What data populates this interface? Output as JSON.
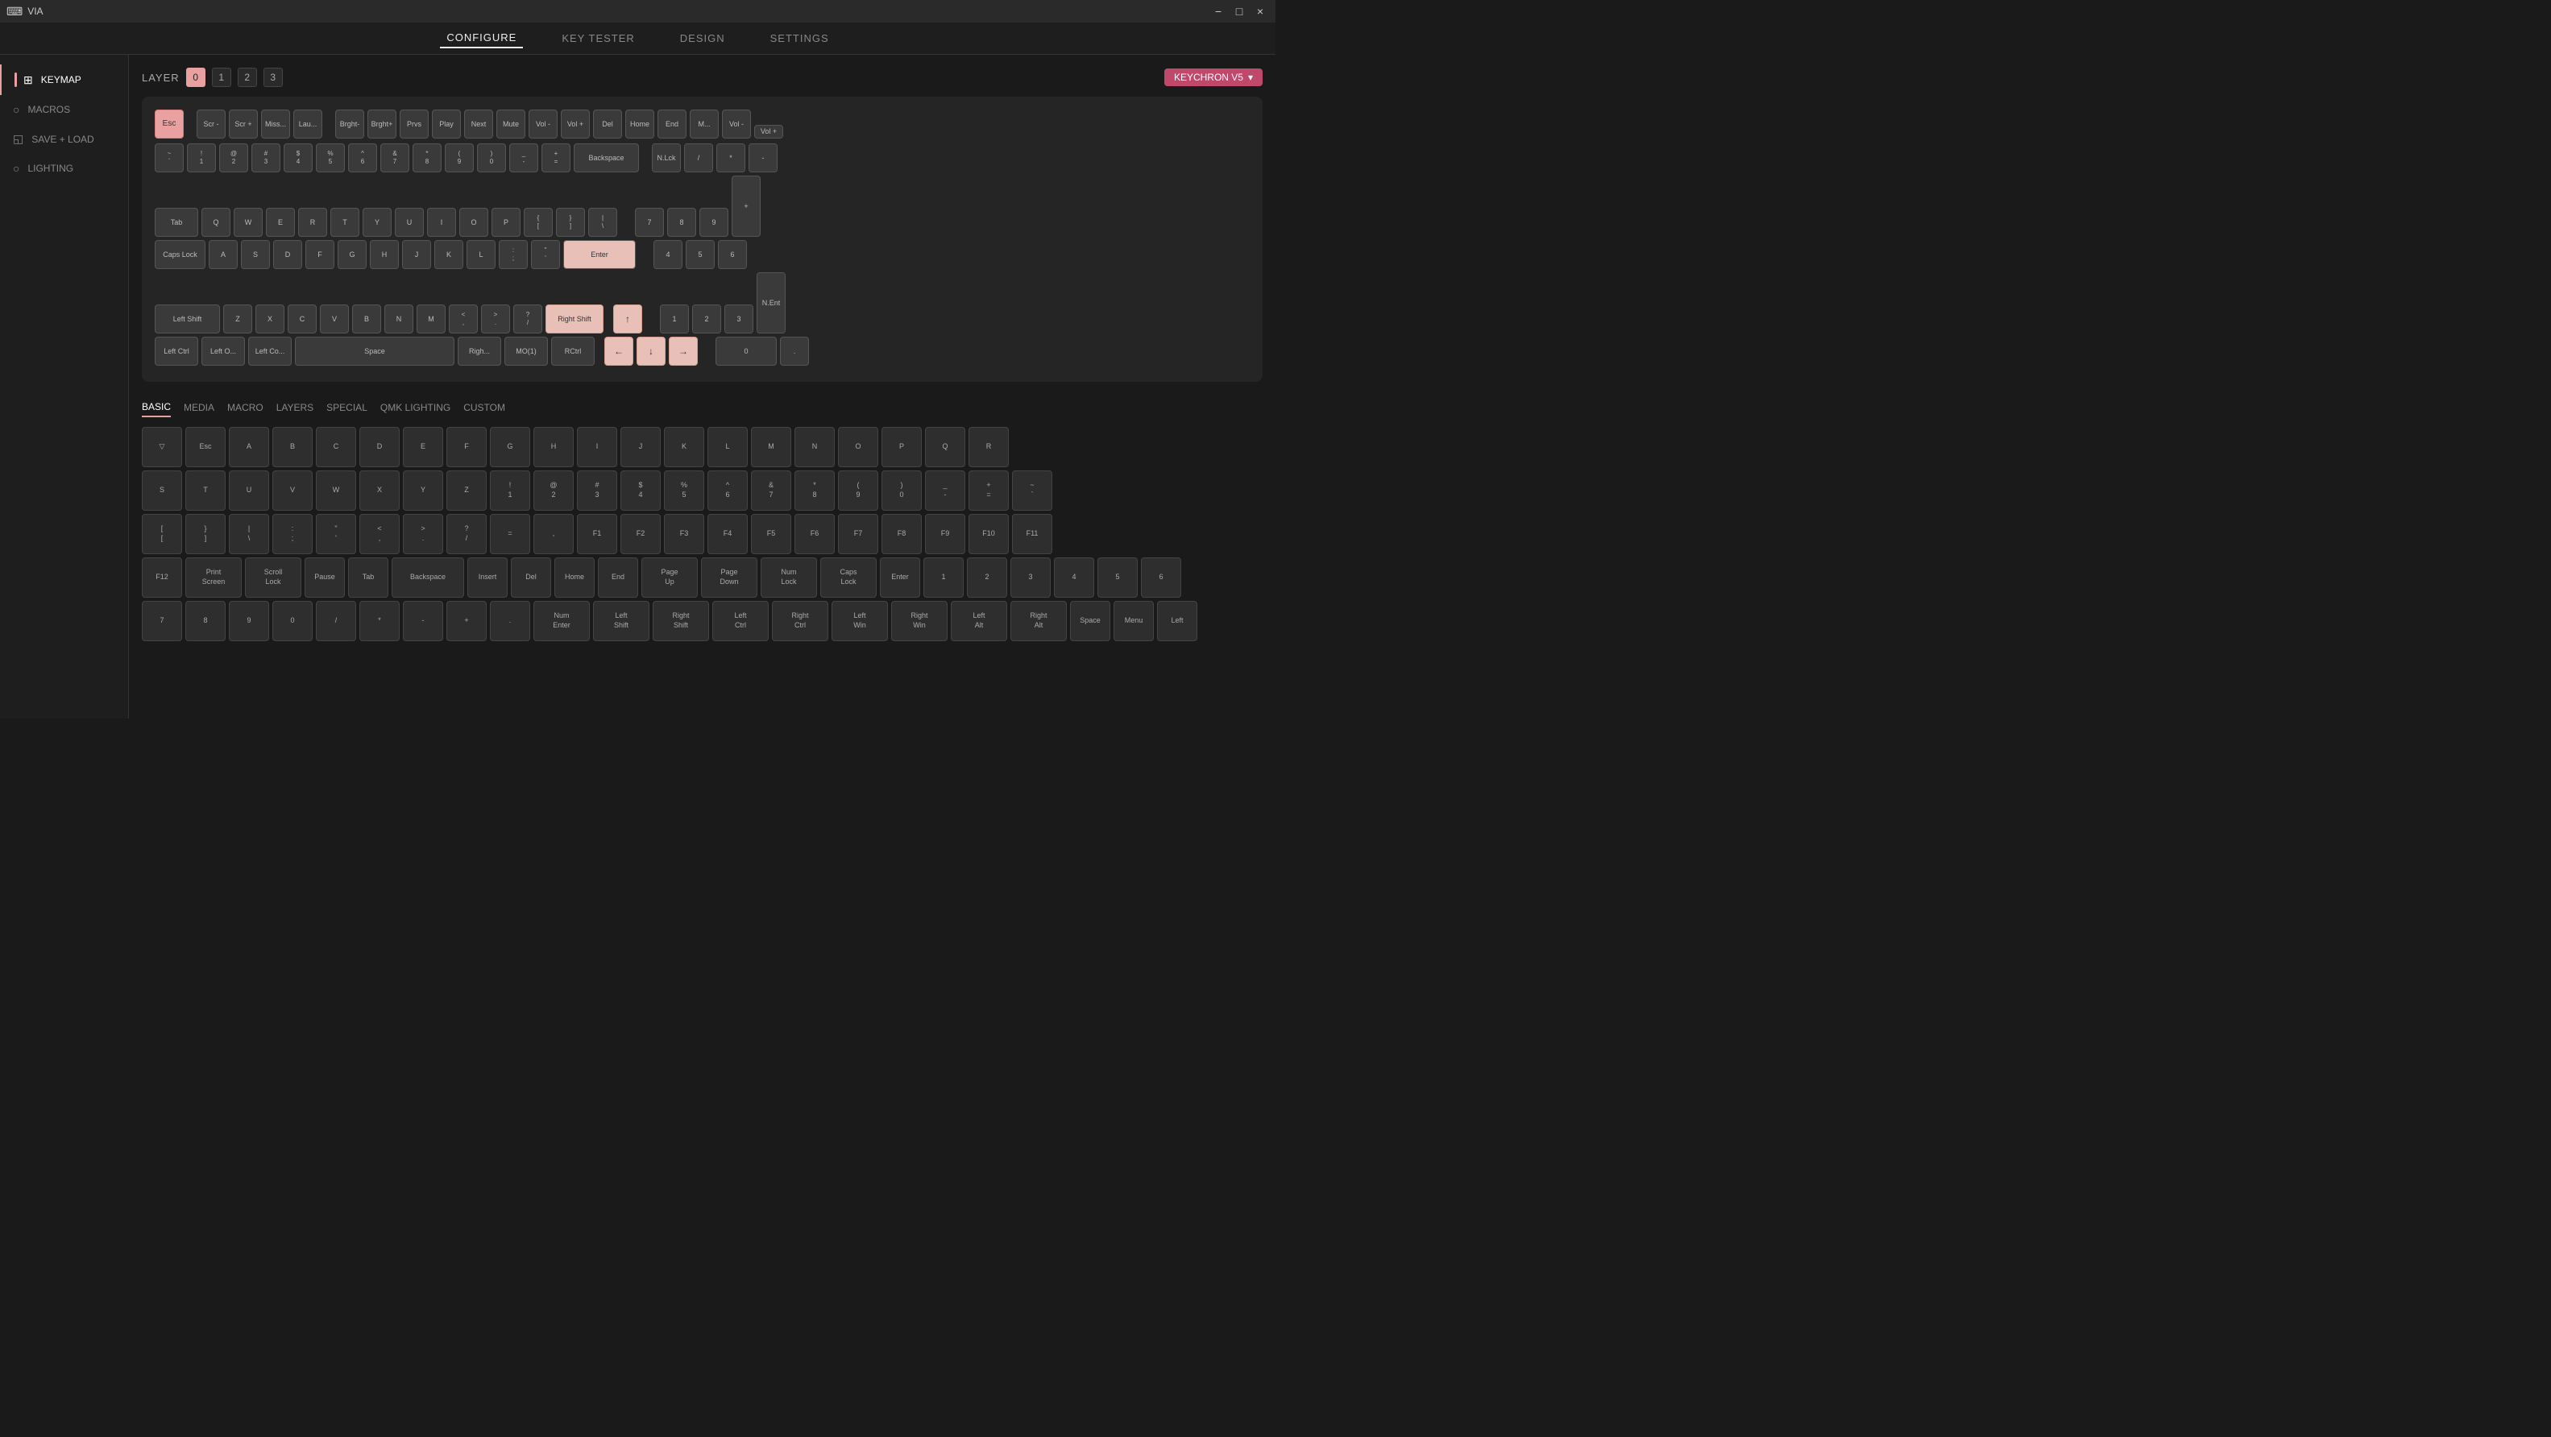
{
  "titlebar": {
    "app_name": "VIA",
    "minimize_label": "−",
    "maximize_label": "□",
    "close_label": "×"
  },
  "topnav": {
    "items": [
      {
        "id": "configure",
        "label": "CONFIGURE",
        "active": true
      },
      {
        "id": "key_tester",
        "label": "KEY TESTER",
        "active": false
      },
      {
        "id": "design",
        "label": "DESIGN",
        "active": false
      },
      {
        "id": "settings",
        "label": "SETTINGS",
        "active": false
      }
    ]
  },
  "sidebar": {
    "items": [
      {
        "id": "keymap",
        "label": "KEYMAP",
        "icon": "⊞",
        "active": true
      },
      {
        "id": "macros",
        "label": "MACROS",
        "icon": "○",
        "active": false
      },
      {
        "id": "save_load",
        "label": "SAVE + LOAD",
        "icon": "◱",
        "active": false
      },
      {
        "id": "lighting",
        "label": "LIGHTING",
        "icon": "○",
        "active": false
      }
    ]
  },
  "keyboard": {
    "selector_label": "KEYCHRON V5",
    "layer_label": "LAYER",
    "layers": [
      "0",
      "1",
      "2",
      "3"
    ],
    "active_layer": "0"
  },
  "keyboard_keys": {
    "row0": [
      "Esc",
      "",
      "Scr -",
      "Scr +",
      "Miss...",
      "Lau...",
      "",
      "Brght-",
      "Brght+",
      "Prvs",
      "Play",
      "Next",
      "Mute",
      "Vol -",
      "Vol +",
      "Del",
      "Home",
      "End",
      "M...",
      "Vol -",
      "",
      "Vol +"
    ],
    "row1": [
      "~\n`",
      "!\n1",
      "@\n2",
      "#\n3",
      "$\n4",
      "%\n5",
      "^\n6",
      "&\n7",
      "*\n8",
      "(\n9",
      ")\n0",
      "_\n-",
      "+\n=",
      "Backspace",
      "",
      "N.Lck",
      "/",
      "*",
      "-"
    ],
    "row2": [
      "Tab",
      "Q",
      "W",
      "E",
      "R",
      "T",
      "Y",
      "U",
      "I",
      "O",
      "P",
      "{\n[",
      "}\n]",
      "|\n\\",
      "",
      "7",
      "8",
      "9",
      "+"
    ],
    "row3": [
      "Caps Lock",
      "A",
      "S",
      "D",
      "F",
      "G",
      "H",
      "J",
      "K",
      "L",
      ":\n;",
      "\"\n'",
      "Enter",
      "",
      "4",
      "5",
      "6"
    ],
    "row4": [
      "Left Shift",
      "Z",
      "X",
      "C",
      "V",
      "B",
      "N",
      "M",
      "<\n,",
      ">\n.",
      "?\n/",
      "Right Shift",
      "",
      "↑",
      "",
      "1",
      "2",
      "3",
      "N.Ent"
    ],
    "row5": [
      "Left Ctrl",
      "Left O...",
      "Left Co...",
      "Space",
      "",
      "Righ...",
      "MO(1)",
      "RCtrl",
      "",
      "←",
      "↓",
      "→",
      "",
      "0",
      "."
    ]
  },
  "palette": {
    "categories": [
      {
        "id": "basic",
        "label": "BASIC",
        "active": true
      },
      {
        "id": "media",
        "label": "MEDIA",
        "active": false
      },
      {
        "id": "macro",
        "label": "MACRO",
        "active": false
      },
      {
        "id": "layers",
        "label": "LAYERS",
        "active": false
      },
      {
        "id": "special",
        "label": "SPECIAL",
        "active": false
      },
      {
        "id": "qmk_lighting",
        "label": "QMK LIGHTING",
        "active": false
      },
      {
        "id": "custom",
        "label": "CUSTOM",
        "active": false
      }
    ],
    "rows": [
      [
        {
          "label": "",
          "sub": "▽"
        },
        {
          "label": "Esc"
        },
        {
          "label": "A"
        },
        {
          "label": "B"
        },
        {
          "label": "C"
        },
        {
          "label": "D"
        },
        {
          "label": "E"
        },
        {
          "label": "F"
        },
        {
          "label": "G"
        },
        {
          "label": "H"
        },
        {
          "label": "I"
        },
        {
          "label": "J"
        },
        {
          "label": "K"
        },
        {
          "label": "L"
        },
        {
          "label": "M"
        },
        {
          "label": "N"
        },
        {
          "label": "O"
        },
        {
          "label": "P"
        },
        {
          "label": "Q"
        },
        {
          "label": "R"
        }
      ],
      [
        {
          "label": "S"
        },
        {
          "label": "T"
        },
        {
          "label": "U"
        },
        {
          "label": "V"
        },
        {
          "label": "W"
        },
        {
          "label": "X"
        },
        {
          "label": "Y"
        },
        {
          "label": "Z"
        },
        {
          "label": "!\n1"
        },
        {
          "label": "@\n2"
        },
        {
          "label": "#\n3"
        },
        {
          "label": "$\n4"
        },
        {
          "label": "%\n5"
        },
        {
          "label": "^\n6"
        },
        {
          "label": "&\n7"
        },
        {
          "label": "*\n8"
        },
        {
          "label": "(\n9"
        },
        {
          "label": ")\n0"
        },
        {
          "label": "_\n-"
        },
        {
          "label": "+\n="
        },
        {
          "label": "~\n`"
        }
      ],
      [
        {
          "label": "[\n["
        },
        {
          "label": "}\n]"
        },
        {
          "label": "|\n\\"
        },
        {
          "label": ":\n;"
        },
        {
          "label": "\"\n'"
        },
        {
          "label": "<\n,"
        },
        {
          "label": ">\n."
        },
        {
          "label": "?\n/"
        },
        {
          "label": "="
        },
        {
          "label": ","
        },
        {
          "label": "F1"
        },
        {
          "label": "F2"
        },
        {
          "label": "F3"
        },
        {
          "label": "F4"
        },
        {
          "label": "F5"
        },
        {
          "label": "F6"
        },
        {
          "label": "F7"
        },
        {
          "label": "F8"
        },
        {
          "label": "F9"
        },
        {
          "label": "F10"
        },
        {
          "label": "F11"
        }
      ],
      [
        {
          "label": "F12"
        },
        {
          "label": "Print\nScreen"
        },
        {
          "label": "Scroll\nLock"
        },
        {
          "label": "Pause"
        },
        {
          "label": "Tab"
        },
        {
          "label": "Backspace"
        },
        {
          "label": "Insert"
        },
        {
          "label": "Del"
        },
        {
          "label": "Home"
        },
        {
          "label": "End"
        },
        {
          "label": "Page\nUp"
        },
        {
          "label": "Page\nDown"
        },
        {
          "label": "Num\nLock"
        },
        {
          "label": "Caps\nLock"
        },
        {
          "label": "Enter"
        },
        {
          "label": "1"
        },
        {
          "label": "2"
        },
        {
          "label": "3"
        },
        {
          "label": "4"
        },
        {
          "label": "5"
        },
        {
          "label": "6"
        }
      ],
      [
        {
          "label": "7"
        },
        {
          "label": "8"
        },
        {
          "label": "9"
        },
        {
          "label": "0"
        },
        {
          "label": "/"
        },
        {
          "label": "*"
        },
        {
          "label": "-"
        },
        {
          "label": "+"
        },
        {
          "label": "."
        },
        {
          "label": "Num\nEnter"
        },
        {
          "label": "Left\nShift"
        },
        {
          "label": "Right\nShift"
        },
        {
          "label": "Left\nCtrl"
        },
        {
          "label": "Right\nCtrl"
        },
        {
          "label": "Left\nWin"
        },
        {
          "label": "Right\nWin"
        },
        {
          "label": "Left\nAlt"
        },
        {
          "label": "Right\nAlt"
        },
        {
          "label": "Space"
        },
        {
          "label": "Menu"
        },
        {
          "label": "Left"
        }
      ]
    ]
  }
}
